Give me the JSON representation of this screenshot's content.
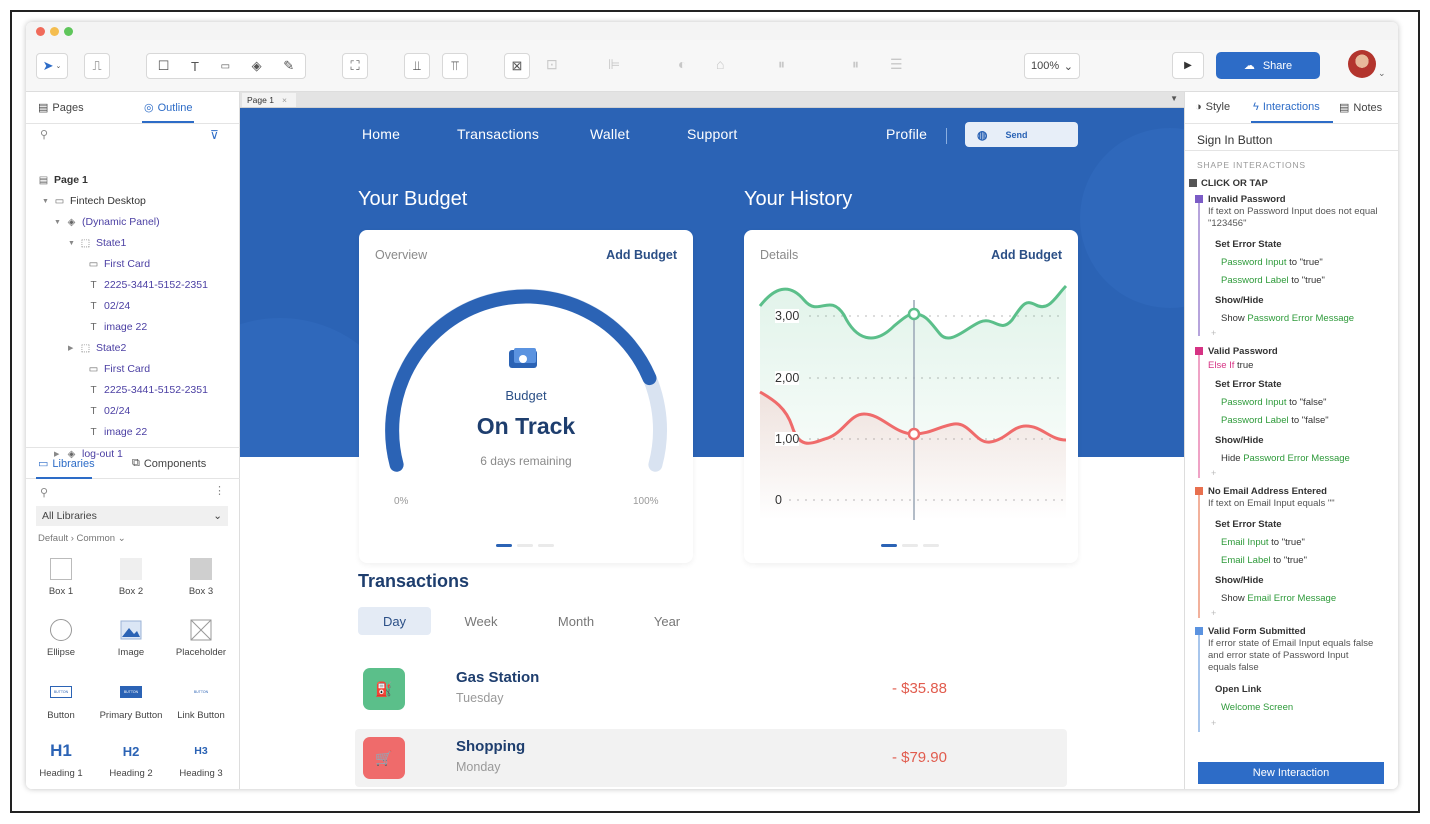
{
  "toolbar": {
    "zoom": "100%",
    "share_label": "Share"
  },
  "left_panel": {
    "tabs": [
      "Pages",
      "Outline"
    ],
    "outline": [
      {
        "label": "Page 1"
      },
      {
        "label": "Fintech Desktop"
      },
      {
        "label": "(Dynamic Panel)"
      },
      {
        "label": "State1"
      },
      {
        "label": "First Card"
      },
      {
        "label": "2225-3441-5152-2351"
      },
      {
        "label": "02/24"
      },
      {
        "label": "image 22"
      },
      {
        "label": "State2"
      },
      {
        "label": "First Card"
      },
      {
        "label": "2225-3441-5152-2351"
      },
      {
        "label": "02/24"
      },
      {
        "label": "image 22"
      },
      {
        "label": "log-out 1"
      }
    ],
    "lib_tabs": [
      "Libraries",
      "Components"
    ],
    "lib_select": "All Libraries",
    "lib_crumb": "Default › Common ⌄",
    "widgets": [
      {
        "label": "Box 1"
      },
      {
        "label": "Box 2"
      },
      {
        "label": "Box 3"
      },
      {
        "label": "Ellipse"
      },
      {
        "label": "Image"
      },
      {
        "label": "Placeholder"
      },
      {
        "label": "Button",
        "thumb": "BUTTON"
      },
      {
        "label": "Primary Button",
        "thumb": "BUTTON"
      },
      {
        "label": "Link Button",
        "thumb": "BUTTON"
      },
      {
        "label": "Heading 1",
        "thumb": "H1"
      },
      {
        "label": "Heading 2",
        "thumb": "H2"
      },
      {
        "label": "Heading 3",
        "thumb": "H3"
      }
    ]
  },
  "canvas": {
    "page_tab": "Page 1",
    "nav": [
      "Home",
      "Transactions",
      "Wallet",
      "Support",
      "Profile"
    ],
    "send_label": "Send",
    "budget": {
      "title": "Your Budget",
      "overview": "Overview",
      "add": "Add Budget",
      "label": "Budget",
      "status": "On Track",
      "remaining": "6 days remaining",
      "min": "0%",
      "max": "100%",
      "progress": 0.82
    },
    "history": {
      "title": "Your History",
      "details": "Details",
      "add": "Add Budget",
      "y_labels": [
        "3,00",
        "2,00",
        "1,00",
        "0"
      ]
    },
    "transactions": {
      "title": "Transactions",
      "periods": [
        "Day",
        "Week",
        "Month",
        "Year"
      ],
      "items": [
        {
          "name": "Gas Station",
          "day": "Tuesday",
          "amount": "- $35.88"
        },
        {
          "name": "Shopping",
          "day": "Monday",
          "amount": "- $79.90"
        }
      ]
    },
    "colors": {
      "primary": "#2b63b5",
      "green": "#5bbf8a",
      "red": "#ef6b6b"
    }
  },
  "right_panel": {
    "tabs": [
      "Style",
      "Interactions",
      "Notes"
    ],
    "selected": "Sign In Button",
    "section": "SHAPE INTERACTIONS",
    "event": "CLICK OR TAP",
    "cases": [
      {
        "name": "Invalid Password",
        "condition": "If text on Password Input does not equal \"123456\"",
        "set_error": "Set Error State",
        "t1": "Password Input",
        "v1": " to \"true\"",
        "t2": "Password Label",
        "v2": " to \"true\"",
        "show_hide": "Show/Hide",
        "action": "Show ",
        "action_target": "Password Error Message"
      },
      {
        "name": "Valid Password",
        "else_if": "Else If",
        "cond_rest": " true",
        "set_error": "Set Error State",
        "t1": "Password Input",
        "v1": " to \"false\"",
        "t2": "Password Label",
        "v2": " to \"false\"",
        "show_hide": "Show/Hide",
        "action": "Hide ",
        "action_target": "Password Error Message"
      },
      {
        "name": "No Email Address Entered",
        "condition": "If text on Email Input equals \"\"",
        "set_error": "Set Error State",
        "t1": "Email Input",
        "v1": " to \"true\"",
        "t2": "Email Label",
        "v2": " to \"true\"",
        "show_hide": "Show/Hide",
        "action": "Show ",
        "action_target": "Email Error Message"
      },
      {
        "name": "Valid Form Submitted",
        "condition": "If error state of Email Input equals false and error state of Password Input equals false",
        "open_link": "Open Link",
        "target": "Welcome Screen"
      }
    ],
    "new_interaction": "New Interaction"
  }
}
